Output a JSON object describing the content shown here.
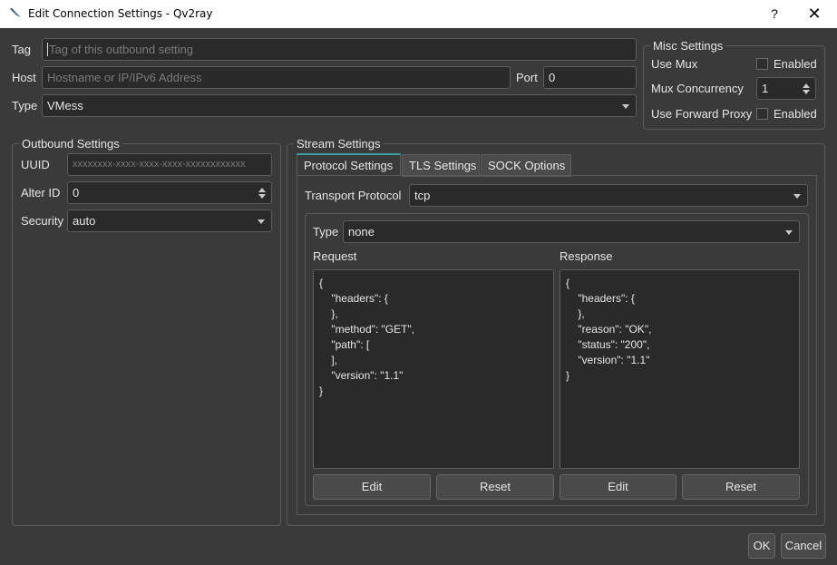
{
  "window": {
    "title": "Edit Connection Settings - Qv2ray",
    "help": "?",
    "close": "✕"
  },
  "top": {
    "tag_label": "Tag",
    "tag_placeholder": "Tag of this outbound setting",
    "host_label": "Host",
    "host_placeholder": "Hostname or IP/IPv6 Address",
    "port_label": "Port",
    "port_value": "0",
    "type_label": "Type",
    "type_value": "VMess"
  },
  "misc": {
    "title": "Misc Settings",
    "use_mux_label": "Use Mux",
    "use_mux_check": "Enabled",
    "mux_concurrency_label": "Mux Concurrency",
    "mux_concurrency_value": "1",
    "forward_proxy_label": "Use Forward Proxy",
    "forward_proxy_check": "Enabled"
  },
  "outbound": {
    "title": "Outbound Settings",
    "uuid_label": "UUID",
    "uuid_placeholder": "xxxxxxxx-xxxx-xxxx-xxxx-xxxxxxxxxxxx",
    "alter_id_label": "Alter ID",
    "alter_id_value": "0",
    "security_label": "Security",
    "security_value": "auto"
  },
  "stream": {
    "title": "Stream Settings",
    "tabs": [
      "Protocol Settings",
      "TLS Settings",
      "SOCK Options"
    ],
    "transport_label": "Transport Protocol",
    "transport_value": "tcp",
    "type_label": "Type",
    "type_value": "none",
    "request_label": "Request",
    "request_text": "{\n    \"headers\": {\n    },\n    \"method\": \"GET\",\n    \"path\": [\n    ],\n    \"version\": \"1.1\"\n}",
    "response_label": "Response",
    "response_text": "{\n    \"headers\": {\n    },\n    \"reason\": \"OK\",\n    \"status\": \"200\",\n    \"version\": \"1.1\"\n}",
    "edit_label": "Edit",
    "reset_label": "Reset"
  },
  "footer": {
    "ok": "OK",
    "cancel": "Cancel"
  }
}
